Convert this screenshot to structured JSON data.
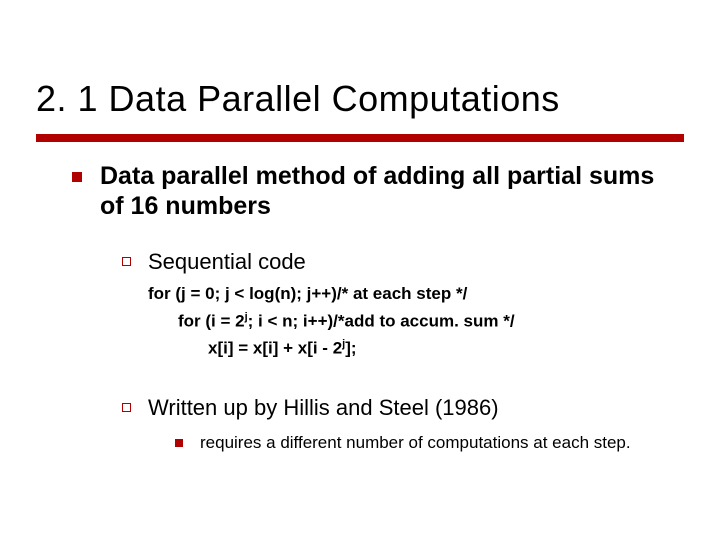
{
  "title": "2. 1 Data Parallel Computations",
  "bullets": [
    {
      "text": "Data parallel method of adding all partial sums of 16 numbers",
      "children": [
        {
          "text": "Sequential code",
          "code": {
            "0": "for (j = 0; j < log(n); j++)/* at each step */",
            "1a": "for (i = 2",
            "1sup": "j",
            "1b": "; i < n; i++)/*add to accum. sum */",
            "2a": "x[i] = x[i] + x[i - 2",
            "2sup": "j",
            "2b": "];"
          }
        },
        {
          "text": "Written up by Hillis and Steel (1986)",
          "children": [
            {
              "text": "requires a different number of computations at each step."
            }
          ]
        }
      ]
    }
  ]
}
